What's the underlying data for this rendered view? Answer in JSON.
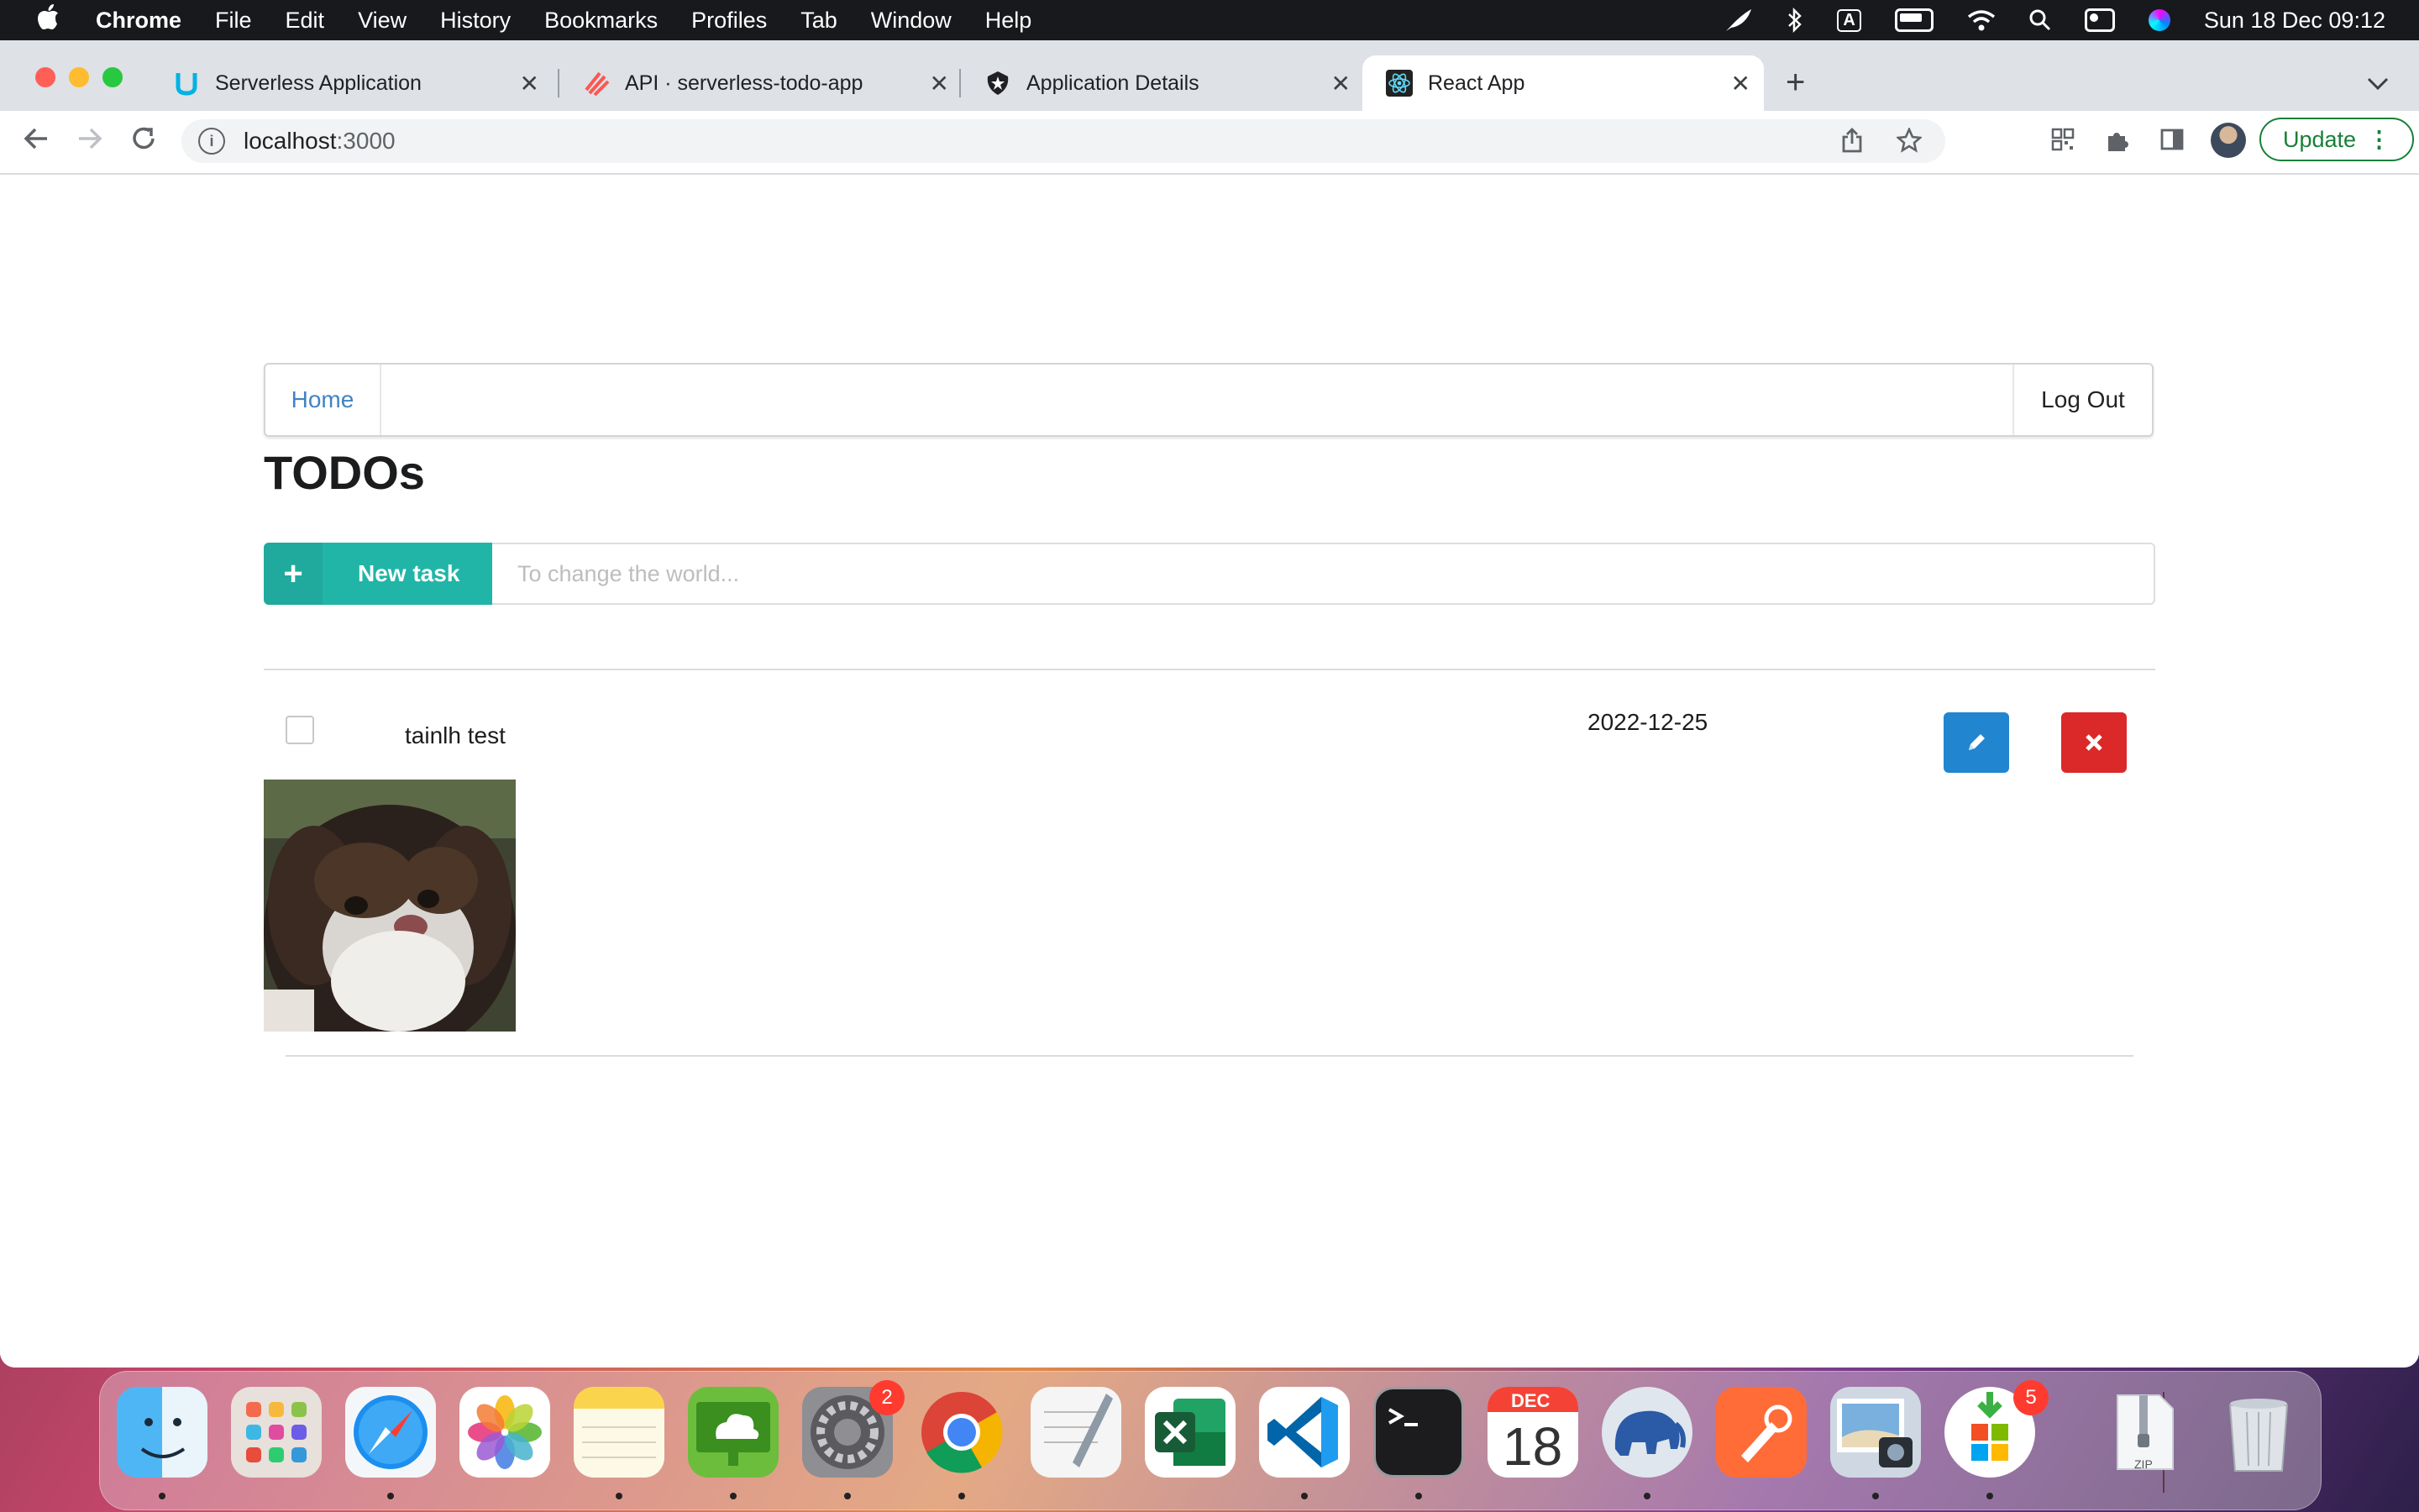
{
  "menubar": {
    "app_name": "Chrome",
    "menus": [
      "File",
      "Edit",
      "View",
      "History",
      "Bookmarks",
      "Profiles",
      "Tab",
      "Window",
      "Help"
    ],
    "keyboard_indicator": "A",
    "datetime": "Sun 18 Dec  09:12"
  },
  "tabs": [
    {
      "title": "Serverless Application",
      "icon": "udacity-icon",
      "active": false
    },
    {
      "title": "API · serverless-todo-app",
      "icon": "serverless-icon",
      "active": false
    },
    {
      "title": "Application Details",
      "icon": "auth0-icon",
      "active": false
    },
    {
      "title": "React App",
      "icon": "react-icon",
      "active": true
    }
  ],
  "address_bar": {
    "host": "localhost",
    "port": ":3000"
  },
  "toolbar": {
    "update_label": "Update"
  },
  "navbar": {
    "home_label": "Home",
    "logout_label": "Log Out"
  },
  "page": {
    "title": "TODOs",
    "new_task_label": "New task",
    "new_task_placeholder": "To change the world..."
  },
  "todos": [
    {
      "name": "tainlh test",
      "due_date": "2022-12-25",
      "done": false,
      "has_image": true
    }
  ],
  "dock": {
    "apps": [
      "Finder",
      "Launchpad",
      "Safari",
      "Photos",
      "Notes",
      "Remote Desktop",
      "System Preferences",
      "Chrome",
      "TextEdit",
      "Excel",
      "Visual Studio Code",
      "Terminal",
      "Calendar",
      "TablePlus",
      "Postman",
      "Preview",
      "App Store"
    ],
    "settings_badge": "2",
    "appstore_badge": "5",
    "calendar_month": "DEC",
    "calendar_day": "18",
    "zip_label": "ZIP"
  },
  "colors": {
    "teal_button": "#21b5a7",
    "edit_button": "#2185d0",
    "delete_button": "#db2828",
    "link": "#4183c4",
    "update_green": "#188038"
  }
}
